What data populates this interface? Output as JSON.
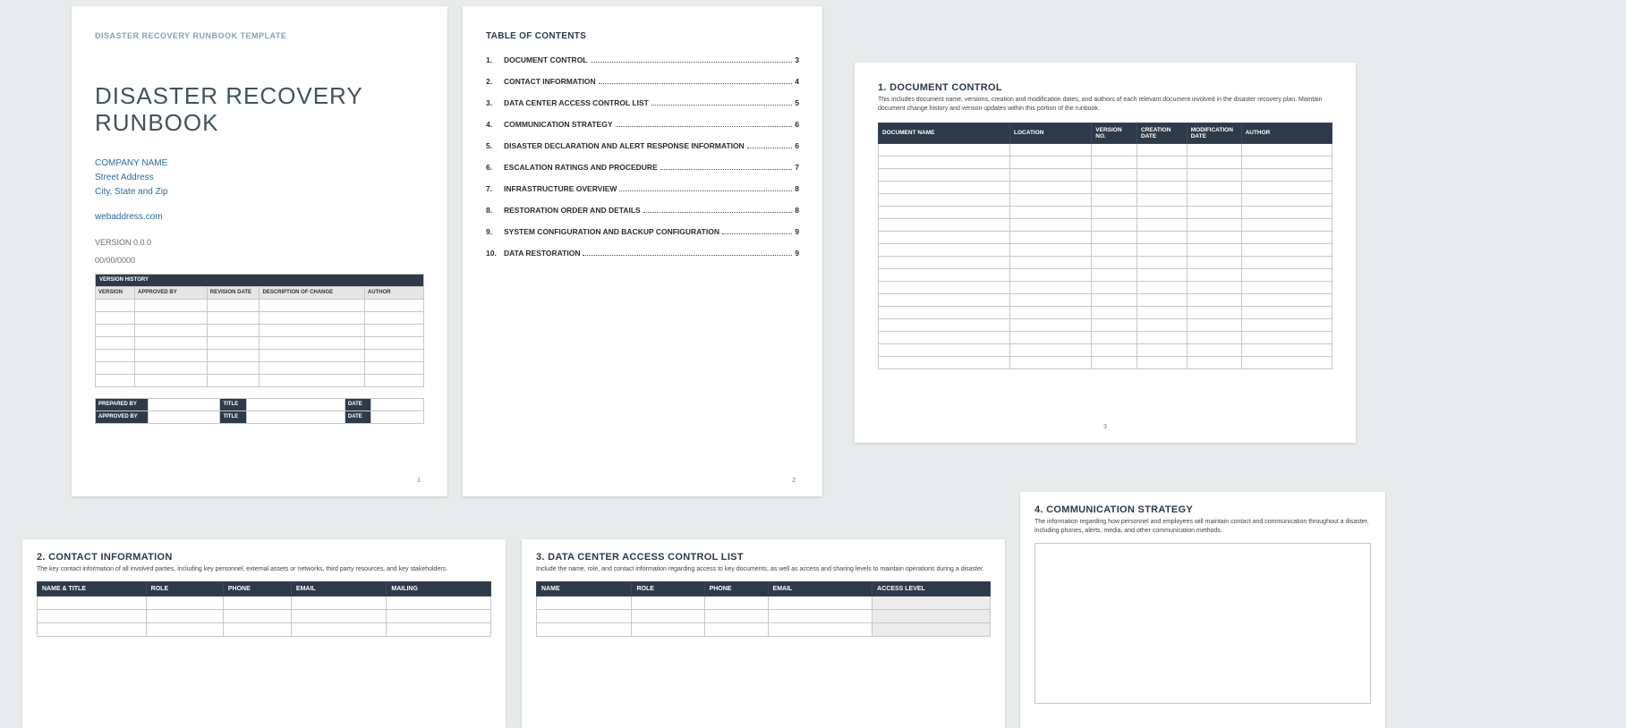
{
  "page1": {
    "template_header": "DISASTER RECOVERY RUNBOOK TEMPLATE",
    "title_line1": "DISASTER RECOVERY",
    "title_line2": "RUNBOOK",
    "company_name": "COMPANY NAME",
    "street": "Street Address",
    "citystate": "City, State and Zip",
    "web": "webaddress.com",
    "version": "VERSION 0.0.0",
    "date": "00/00/0000",
    "version_history_title": "VERSION HISTORY",
    "vh_cols": [
      "VERSION",
      "APPROVED BY",
      "REVISION DATE",
      "DESCRIPTION OF CHANGE",
      "AUTHOR"
    ],
    "sig": {
      "prepared": "PREPARED BY",
      "approved": "APPROVED BY",
      "title": "TITLE",
      "date": "DATE"
    },
    "pagenum": "1"
  },
  "page2": {
    "toc_title": "TABLE OF CONTENTS",
    "items": [
      {
        "n": "1.",
        "label": "DOCUMENT CONTROL",
        "p": "3"
      },
      {
        "n": "2.",
        "label": "CONTACT INFORMATION",
        "p": "4"
      },
      {
        "n": "3.",
        "label": "DATA CENTER ACCESS CONTROL LIST",
        "p": "5"
      },
      {
        "n": "4.",
        "label": "COMMUNICATION STRATEGY",
        "p": "6"
      },
      {
        "n": "5.",
        "label": "DISASTER DECLARATION AND ALERT RESPONSE INFORMATION",
        "p": "6"
      },
      {
        "n": "6.",
        "label": "ESCALATION RATINGS AND PROCEDURE",
        "p": "7"
      },
      {
        "n": "7.",
        "label": "INFRASTRUCTURE OVERVIEW",
        "p": "8"
      },
      {
        "n": "8.",
        "label": "RESTORATION ORDER AND DETAILS",
        "p": "8"
      },
      {
        "n": "9.",
        "label": "SYSTEM CONFIGURATION AND BACKUP CONFIGURATION",
        "p": "9"
      },
      {
        "n": "10.",
        "label": "DATA RESTORATION",
        "p": "9"
      }
    ],
    "pagenum": "2"
  },
  "page3": {
    "heading": "1.  DOCUMENT CONTROL",
    "sub": "This includes document name, versions, creation and modification dates, and authors of each relevant document involved in the disaster recovery plan. Maintain document change history and version updates within this portion of the runbook.",
    "cols": [
      "DOCUMENT NAME",
      "LOCATION",
      "VERSION NO.",
      "CREATION DATE",
      "MODIFICATION DATE",
      "AUTHOR"
    ],
    "rows": 18,
    "pagenum": "3"
  },
  "page4": {
    "heading": "4.  COMMUNICATION STRATEGY",
    "sub": "The information regarding how personnel and employees will maintain contact and communication throughout a disaster, including phones, alerts, media, and other communication methods."
  },
  "pageContact": {
    "heading": "2.  CONTACT INFORMATION",
    "sub": "The key contact information of all involved parties, including key personnel, external assets or networks, third party resources, and key stakeholders.",
    "cols": [
      "NAME & TITLE",
      "ROLE",
      "PHONE",
      "EMAIL",
      "MAILING"
    ]
  },
  "pageDC": {
    "heading": "3.  DATA CENTER ACCESS CONTROL LIST",
    "sub": "Include the name, role, and contact information regarding access to key documents, as well as access and sharing levels to maintain operations during a disaster.",
    "cols": [
      "NAME",
      "ROLE",
      "PHONE",
      "EMAIL",
      "ACCESS LEVEL"
    ]
  }
}
